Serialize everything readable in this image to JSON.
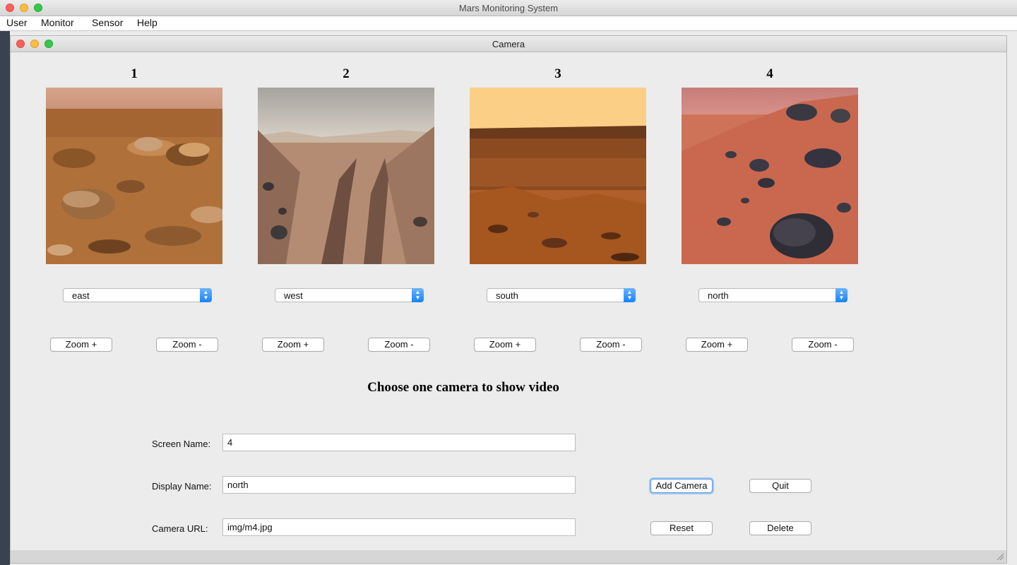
{
  "app": {
    "title": "Mars Monitoring System"
  },
  "menu": [
    "User",
    "Monitor",
    "Sensor",
    "Help"
  ],
  "camera_window": {
    "title": "Camera"
  },
  "cameras": [
    {
      "number": "1",
      "direction": "east"
    },
    {
      "number": "2",
      "direction": "west"
    },
    {
      "number": "3",
      "direction": "south"
    },
    {
      "number": "4",
      "direction": "north"
    }
  ],
  "zoom": {
    "in_label": "Zoom +",
    "out_label": "Zoom -"
  },
  "heading": "Choose one camera to show video",
  "form": {
    "screen_name_label": "Screen Name:",
    "screen_name_value": "4",
    "display_name_label": "Display Name:",
    "display_name_value": "north",
    "camera_url_label": "Camera URL:",
    "camera_url_value": "img/m4.jpg"
  },
  "actions": {
    "add": "Add Camera",
    "quit": "Quit",
    "reset": "Reset",
    "delete": "Delete"
  }
}
